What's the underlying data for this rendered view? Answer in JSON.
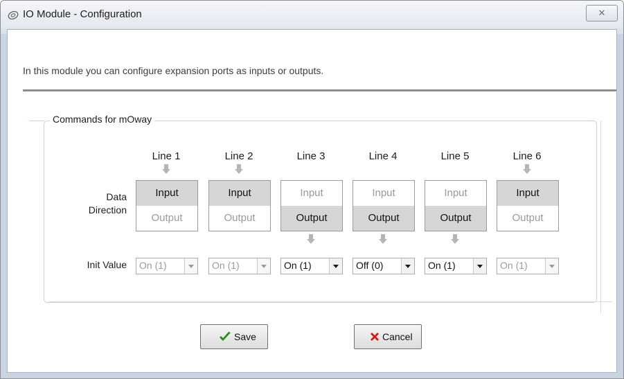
{
  "window": {
    "title": "IO Module - Configuration",
    "close_label": "✕"
  },
  "description": "In this module you can configure expansion ports as inputs or outputs.",
  "group": {
    "caption": "Commands for mOway",
    "data_direction_label": "Data\nDirection",
    "init_value_label": "Init Value"
  },
  "lines": [
    {
      "label": "Line 1",
      "input": "Input",
      "output": "Output",
      "selected": "Input",
      "init_value": "On (1)",
      "init_enabled": false
    },
    {
      "label": "Line 2",
      "input": "Input",
      "output": "Output",
      "selected": "Input",
      "init_value": "On (1)",
      "init_enabled": false
    },
    {
      "label": "Line 3",
      "input": "Input",
      "output": "Output",
      "selected": "Output",
      "init_value": "On (1)",
      "init_enabled": true
    },
    {
      "label": "Line 4",
      "input": "Input",
      "output": "Output",
      "selected": "Output",
      "init_value": "Off (0)",
      "init_enabled": true
    },
    {
      "label": "Line 5",
      "input": "Input",
      "output": "Output",
      "selected": "Output",
      "init_value": "On (1)",
      "init_enabled": true
    },
    {
      "label": "Line 6",
      "input": "Input",
      "output": "Output",
      "selected": "Input",
      "init_value": "On (1)",
      "init_enabled": false
    }
  ],
  "buttons": {
    "save": "Save",
    "cancel": "Cancel"
  },
  "colors": {
    "save_check": "#2e8b1e",
    "cancel_x": "#d21a1a",
    "selected_option_bg": "#d6d6d6",
    "arrow": "#b5b5b5"
  }
}
